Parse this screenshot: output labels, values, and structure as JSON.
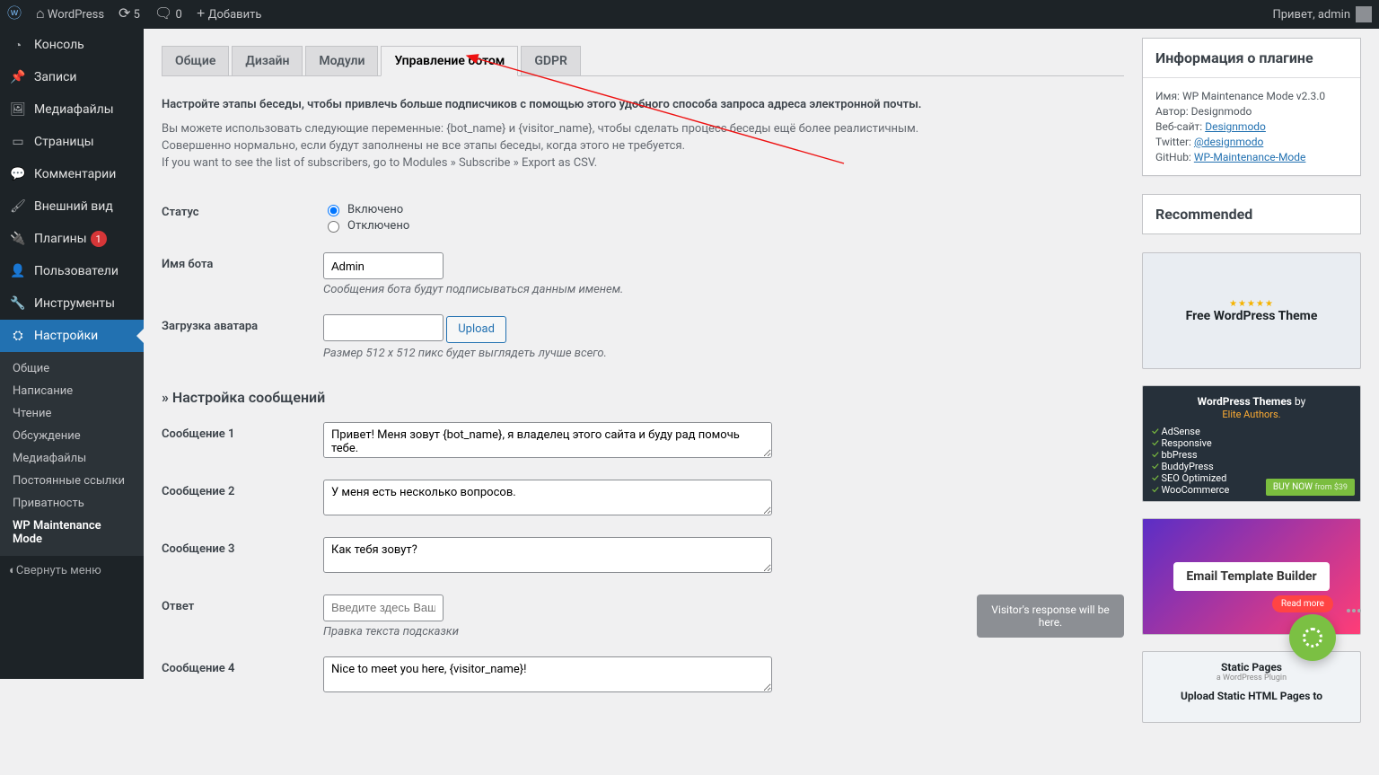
{
  "adminbar": {
    "site_name": "WordPress",
    "updates_count": "5",
    "comments_count": "0",
    "add_new": "Добавить",
    "greeting": "Привет, admin"
  },
  "sidebar": {
    "items": [
      {
        "icon": "◔",
        "label": "Консоль",
        "name": "dashboard"
      },
      {
        "icon": "📌",
        "label": "Записи",
        "name": "posts"
      },
      {
        "icon": "🖼",
        "label": "Медиафайлы",
        "name": "media"
      },
      {
        "icon": "▭",
        "label": "Страницы",
        "name": "pages"
      },
      {
        "icon": "💬",
        "label": "Комментарии",
        "name": "comments"
      },
      {
        "icon": "🖌",
        "label": "Внешний вид",
        "name": "appearance"
      },
      {
        "icon": "🔌",
        "label": "Плагины",
        "name": "plugins",
        "badge": "1"
      },
      {
        "icon": "👤",
        "label": "Пользователи",
        "name": "users"
      },
      {
        "icon": "🔧",
        "label": "Инструменты",
        "name": "tools"
      },
      {
        "icon": "⛭",
        "label": "Настройки",
        "name": "settings",
        "current": true
      }
    ],
    "submenu": [
      {
        "label": "Общие"
      },
      {
        "label": "Написание"
      },
      {
        "label": "Чтение"
      },
      {
        "label": "Обсуждение"
      },
      {
        "label": "Медиафайлы"
      },
      {
        "label": "Постоянные ссылки"
      },
      {
        "label": "Приватность"
      },
      {
        "label": "WP Maintenance Mode",
        "current": true
      }
    ],
    "collapse": "Свернуть меню"
  },
  "tabs": [
    {
      "label": "Общие"
    },
    {
      "label": "Дизайн"
    },
    {
      "label": "Модули"
    },
    {
      "label": "Управление ботом",
      "active": true
    },
    {
      "label": "GDPR"
    }
  ],
  "intro": {
    "lead": "Настройте этапы беседы, чтобы привлечь больше подписчиков с помощью этого удобного способа запроса адреса электронной почты.",
    "p1": "Вы можете использовать следующие переменные: {bot_name} и {visitor_name}, чтобы сделать процесс беседы ещё более реалистичным.",
    "p2": "Совершенно нормально, если будут заполнены не все этапы беседы, когда этого не требуется.",
    "p3": "If you want to see the list of subscribers, go to Modules » Subscribe » Export as CSV."
  },
  "form": {
    "status_label": "Статус",
    "status_on": "Включено",
    "status_off": "Отключено",
    "botname_label": "Имя бота",
    "botname_value": "Admin",
    "botname_help": "Сообщения бота будут подписываться данным именем.",
    "avatar_label": "Загрузка аватара",
    "avatar_button": "Upload",
    "avatar_help": "Размер 512 x 512 пикс будет выглядеть лучше всего.",
    "messages_heading": "» Настройка сообщений",
    "msg1_label": "Сообщение 1",
    "msg1_value": "Привет! Меня зовут {bot_name}, я владелец этого сайта и буду рад помочь тебе.",
    "msg2_label": "Сообщение 2",
    "msg2_value": "У меня есть несколько вопросов.",
    "msg3_label": "Сообщение 3",
    "msg3_value": "Как тебя зовут?",
    "answer_label": "Ответ",
    "answer_placeholder": "Введите здесь Ваше им",
    "answer_help": "Правка текста подсказки",
    "visitor_box": "Visitor's response will be here.",
    "msg4_label": "Сообщение 4",
    "msg4_value": "Nice to meet you here, {visitor_name}!"
  },
  "plugin_info": {
    "heading": "Информация о плагине",
    "name_label": "Имя:",
    "name_value": "WP Maintenance Mode v2.3.0",
    "author_label": "Автор:",
    "author_value": "Designmodo",
    "website_label": "Веб-сайт:",
    "website_link": "Designmodo",
    "twitter_label": "Twitter:",
    "twitter_link": "@designmodo",
    "github_label": "GitHub:",
    "github_link": "WP-Maintenance-Mode"
  },
  "recommended": {
    "heading": "Recommended",
    "promo1_title": "Free WordPress Theme",
    "promo2_title": "WordPress Themes",
    "promo2_by": "by",
    "promo2_elite": "Elite Authors.",
    "promo2_checks": [
      "AdSense",
      "Responsive",
      "bbPress",
      "BuddyPress",
      "SEO Optimized",
      "WooCommerce"
    ],
    "promo2_buy": "BUY NOW",
    "promo2_price": "from $39",
    "promo3_title": "Email Template Builder",
    "promo3_readmore": "Read more",
    "promo4_title": "Static Pages",
    "promo4_sub": "a WordPress Plugin",
    "promo4_line": "Upload Static HTML Pages to"
  }
}
